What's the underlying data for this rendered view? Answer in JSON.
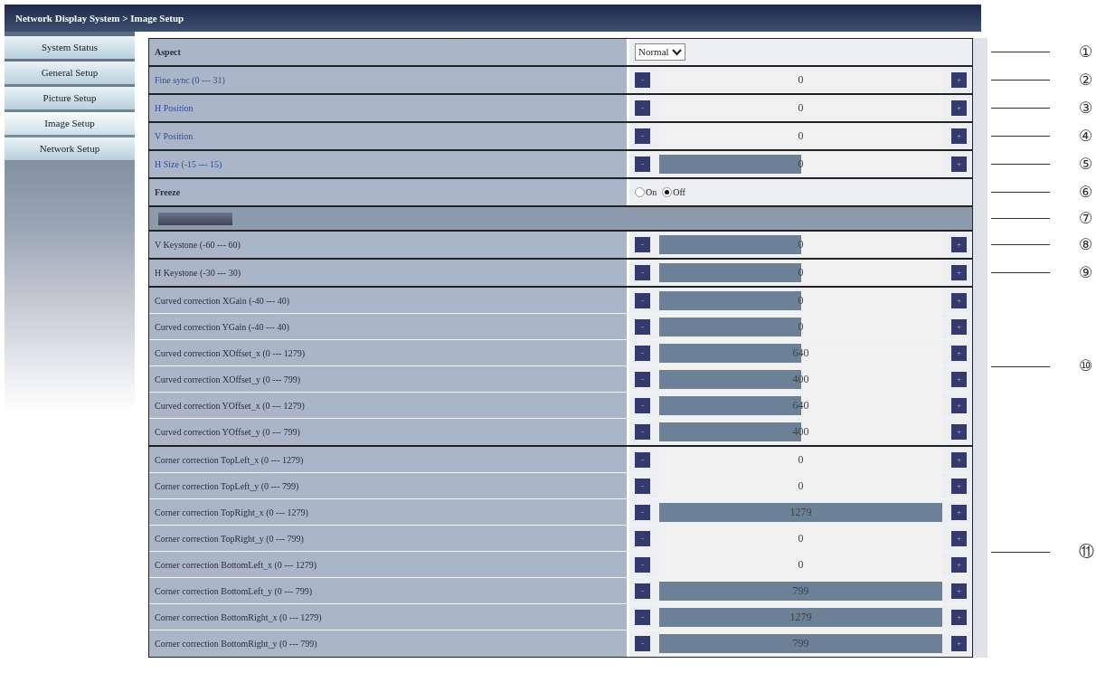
{
  "header": {
    "title": "Network Display System > Image Setup"
  },
  "sidebar": {
    "items": [
      {
        "label": "System Status",
        "selected": false
      },
      {
        "label": "General Setup",
        "selected": false
      },
      {
        "label": "Picture Setup",
        "selected": false
      },
      {
        "label": "Image Setup",
        "selected": true
      },
      {
        "label": "Network Setup",
        "selected": false
      }
    ]
  },
  "groups": [
    {
      "callout": "①",
      "rows": [
        {
          "kind": "select",
          "label": "Aspect",
          "value": "Normal"
        }
      ]
    },
    {
      "callout": "②",
      "rows": [
        {
          "kind": "stepper",
          "label": "Fine sync (0 --- 31)",
          "disabled": true,
          "minus": "-",
          "plus": "+",
          "value": "0"
        }
      ]
    },
    {
      "callout": "③",
      "rows": [
        {
          "kind": "stepper",
          "label": "H Position",
          "disabled": true,
          "minus": "-",
          "plus": "+",
          "value": "0"
        }
      ]
    },
    {
      "callout": "④",
      "rows": [
        {
          "kind": "stepper",
          "label": "V Position",
          "disabled": true,
          "minus": "-",
          "plus": "+",
          "value": "0"
        }
      ]
    },
    {
      "callout": "⑤",
      "rows": [
        {
          "kind": "stepper",
          "label": "H Size (-15 --- 15)",
          "disabled": true,
          "minus": "-",
          "plus": "+",
          "value": "0",
          "level": 0.5
        }
      ]
    },
    {
      "callout": "⑥",
      "rows": [
        {
          "kind": "radio",
          "label": "Freeze",
          "options": [
            {
              "label": "On",
              "selected": false
            },
            {
              "label": "Off",
              "selected": true
            }
          ]
        }
      ]
    },
    {
      "callout": "⑦",
      "rows": [
        {
          "kind": "section"
        }
      ]
    },
    {
      "callout": "⑧",
      "rows": [
        {
          "kind": "stepper",
          "label": "V Keystone (-60 --- 60)",
          "disabled": false,
          "minus": "-",
          "plus": "+",
          "value": "0",
          "level": 0.5
        }
      ]
    },
    {
      "callout": "⑨",
      "rows": [
        {
          "kind": "stepper",
          "label": "H Keystone (-30 --- 30)",
          "disabled": false,
          "minus": "-",
          "plus": "+",
          "value": "0",
          "level": 0.5
        }
      ]
    },
    {
      "callout": "⑩",
      "rows": [
        {
          "kind": "stepper",
          "label": "Curved correction XGain (-40 --- 40)",
          "disabled": false,
          "minus": "-",
          "plus": "+",
          "value": "0",
          "level": 0.5
        },
        {
          "kind": "stepper",
          "label": "Curved correction YGain (-40 --- 40)",
          "disabled": false,
          "minus": "-",
          "plus": "+",
          "value": "0",
          "level": 0.5
        },
        {
          "kind": "stepper",
          "label": "Curved correction XOffset_x (0 --- 1279)",
          "disabled": false,
          "minus": "-",
          "plus": "+",
          "value": "640",
          "level": 0.5
        },
        {
          "kind": "stepper",
          "label": "Curved correction XOffset_y (0 --- 799)",
          "disabled": false,
          "minus": "-",
          "plus": "+",
          "value": "400",
          "level": 0.5
        },
        {
          "kind": "stepper",
          "label": "Curved correction YOffset_x (0 --- 1279)",
          "disabled": false,
          "minus": "-",
          "plus": "+",
          "value": "640",
          "level": 0.5
        },
        {
          "kind": "stepper",
          "label": "Curved correction YOffset_y (0 --- 799)",
          "disabled": false,
          "minus": "-",
          "plus": "+",
          "value": "400",
          "level": 0.5
        }
      ]
    },
    {
      "callout": "⑪",
      "rows": [
        {
          "kind": "stepper",
          "label": "Corner correction TopLeft_x (0 --- 1279)",
          "disabled": false,
          "minus": "-",
          "plus": "+",
          "value": "0",
          "level": 0
        },
        {
          "kind": "stepper",
          "label": "Corner correction TopLeft_y (0 --- 799)",
          "disabled": false,
          "minus": "-",
          "plus": "+",
          "value": "0",
          "level": 0
        },
        {
          "kind": "stepper",
          "label": "Corner correction TopRight_x (0 --- 1279)",
          "disabled": false,
          "minus": "-",
          "plus": "+",
          "value": "1279",
          "level": 1
        },
        {
          "kind": "stepper",
          "label": "Corner correction TopRight_y (0 --- 799)",
          "disabled": false,
          "minus": "-",
          "plus": "+",
          "value": "0",
          "level": 0
        },
        {
          "kind": "stepper",
          "label": "Corner correction BottomLeft_x (0 --- 1279)",
          "disabled": false,
          "minus": "-",
          "plus": "+",
          "value": "0",
          "level": 0
        },
        {
          "kind": "stepper",
          "label": "Corner correction BottomLeft_y (0 --- 799)",
          "disabled": false,
          "minus": "-",
          "plus": "+",
          "value": "799",
          "level": 1
        },
        {
          "kind": "stepper",
          "label": "Corner correction BottomRight_x (0 --- 1279)",
          "disabled": false,
          "minus": "-",
          "plus": "+",
          "value": "1279",
          "level": 1
        },
        {
          "kind": "stepper",
          "label": "Corner correction BottomRight_y (0 --- 799)",
          "disabled": false,
          "minus": "-",
          "plus": "+",
          "value": "799",
          "level": 1
        }
      ]
    }
  ]
}
